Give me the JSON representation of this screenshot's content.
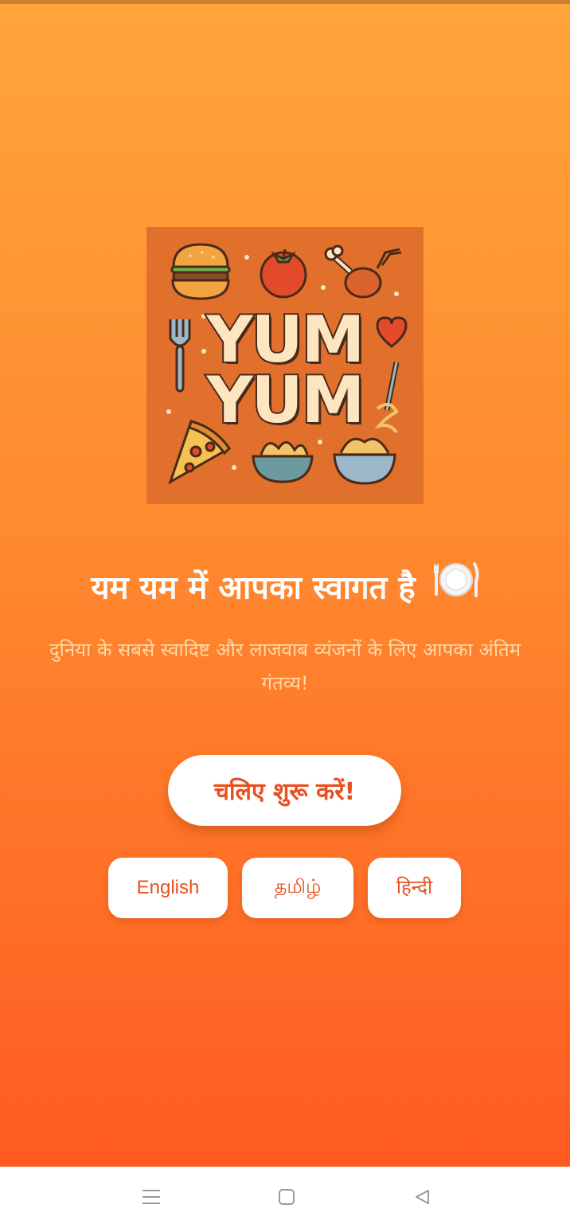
{
  "logo": {
    "line1": "YUM",
    "line2": "YUM"
  },
  "welcome": {
    "title": "यम यम में आपका स्वागत है",
    "subtitle": "दुनिया के सबसे स्वादिष्ट और लाजवाब व्यंजनों के लिए आपका अंतिम गंतव्य!"
  },
  "start_button": {
    "label": "चलिए शुरू करें!"
  },
  "languages": [
    {
      "label": "English"
    },
    {
      "label": "தமிழ்"
    },
    {
      "label": "हिन्दी"
    }
  ],
  "icons": {
    "title_icon": "plate-fork-knife-icon",
    "nav_menu": "menu-icon",
    "nav_home": "home-square-icon",
    "nav_back": "back-triangle-icon"
  },
  "colors": {
    "gradient_top": "#ffa43b",
    "gradient_bottom": "#ff5a22",
    "accent_text": "#e8501f",
    "logo_bg": "#e0702c",
    "logo_text": "#fde5bf"
  }
}
